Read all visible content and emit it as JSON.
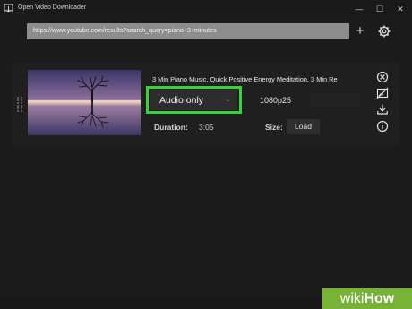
{
  "window": {
    "title": "Open Video Downloader",
    "minimize_glyph": "—",
    "maximize_glyph": "☐",
    "close_glyph": "✕"
  },
  "toolbar": {
    "url_value": "https://www.youtube.com/results?search_query=piano+3+minutes",
    "add_glyph": "+",
    "settings_icon": "gear-icon"
  },
  "video": {
    "title": "3 Min Piano Music, Quick Positive Energy Meditation, 3 Min Re",
    "thumbnail": "tree-reflection-sunset",
    "format": {
      "selected": "Audio only",
      "chevron": "⌄"
    },
    "quality": {
      "selected": "1080p25"
    },
    "duration": {
      "label": "Duration:",
      "value": "3:05"
    },
    "size": {
      "label": "Size:",
      "button": "Load"
    },
    "actions": [
      "close-circle-icon",
      "no-image-icon",
      "download-icon",
      "info-icon"
    ]
  },
  "colors": {
    "background": "#1b1b1b",
    "card": "#1f1f1f",
    "url_field": "#8d8d8d",
    "highlight": "#36d43a"
  },
  "watermark": {
    "part1": "wiki",
    "part2": "How"
  }
}
